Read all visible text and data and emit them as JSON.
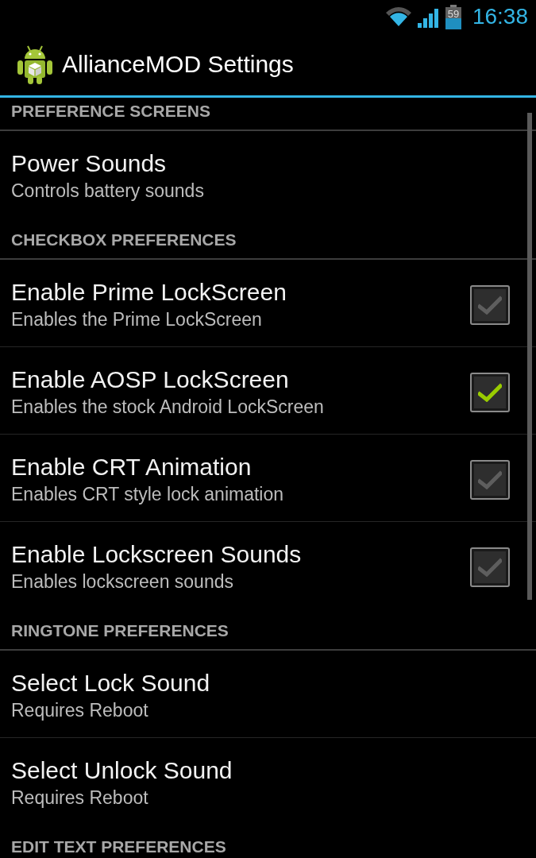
{
  "status_bar": {
    "battery": "59",
    "time": "16:38"
  },
  "action_bar": {
    "title": "AllianceMOD Settings"
  },
  "sections": [
    {
      "header": "PREFERENCE SCREENS",
      "items": [
        {
          "kind": "text",
          "title": "Power Sounds",
          "summary": "Controls battery sounds"
        }
      ]
    },
    {
      "header": "CHECKBOX PREFERENCES",
      "items": [
        {
          "kind": "checkbox",
          "title": "Enable Prime LockScreen",
          "summary": "Enables the Prime LockScreen",
          "checked": false
        },
        {
          "kind": "checkbox",
          "title": "Enable AOSP LockScreen",
          "summary": "Enables the stock Android LockScreen",
          "checked": true
        },
        {
          "kind": "checkbox",
          "title": "Enable CRT Animation",
          "summary": "Enables CRT style lock animation",
          "checked": false
        },
        {
          "kind": "checkbox",
          "title": "Enable Lockscreen Sounds",
          "summary": "Enables lockscreen sounds",
          "checked": false
        }
      ]
    },
    {
      "header": "RINGTONE PREFERENCES",
      "items": [
        {
          "kind": "text",
          "title": "Select Lock Sound",
          "summary": "Requires Reboot"
        },
        {
          "kind": "text",
          "title": "Select Unlock Sound",
          "summary": "Requires Reboot"
        }
      ]
    },
    {
      "header": "EDIT TEXT PREFERENCES"
    }
  ]
}
